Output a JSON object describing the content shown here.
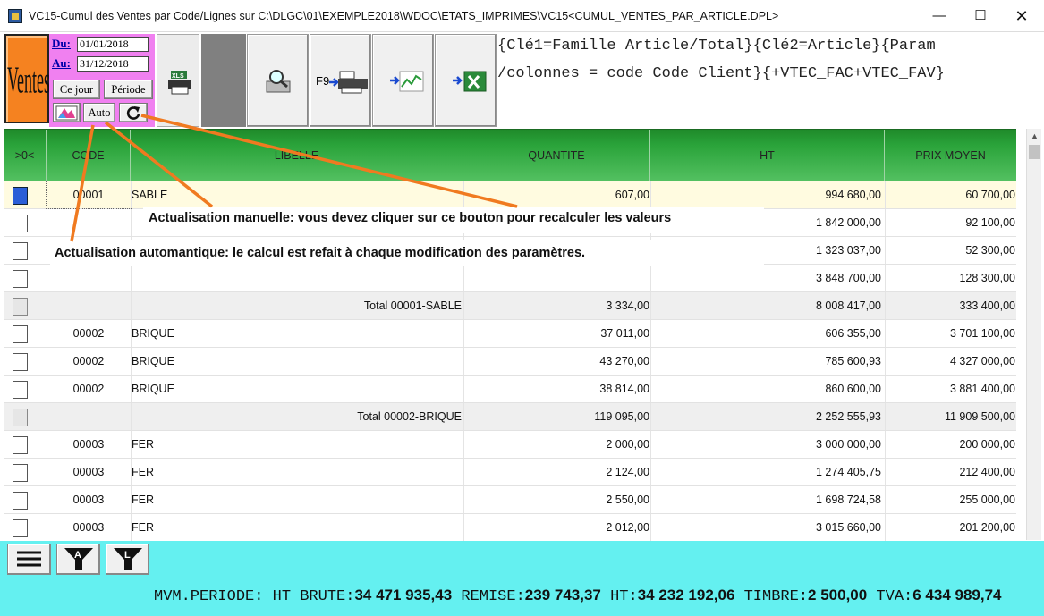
{
  "window": {
    "title": "VC15-Cumul des Ventes par Code/Lignes sur C:\\DLGC\\01\\EXEMPLE2018\\WDOC\\ETATS_IMPRIMES\\VC15<CUMUL_VENTES_PAR_ARTICLE.DPL>",
    "minimize": "—",
    "maximize": "☐",
    "close": "✕"
  },
  "toolbar": {
    "ventes_label": "Ventes",
    "du_label": "Du:",
    "du_value": "01/01/2018",
    "au_label": "Au:",
    "au_value": "31/12/2018",
    "ce_jour": "Ce jour",
    "periode": "Période",
    "auto": "Auto",
    "xls_label": "XLS",
    "f9_label": "F9"
  },
  "params": {
    "line1": "{Clé1=Famille Article/Total}{Clé2=Article}{Param",
    "line2": "/colonnes = code Code Client}{+VTEC_FAC+VTEC_FAV}"
  },
  "grid": {
    "headers": [
      ">0<",
      "CODE",
      "LIBELLE",
      "QUANTITE",
      "HT",
      "PRIX MOYEN"
    ],
    "rows": [
      {
        "type": "sel",
        "code": "00001",
        "lib": "SABLE",
        "q": "607,00",
        "ht": "994 680,00",
        "pm": "60 700,00"
      },
      {
        "type": "data",
        "code": "",
        "lib": "",
        "q": "",
        "ht": "1 842 000,00",
        "pm": "92 100,00"
      },
      {
        "type": "data",
        "code": "",
        "lib": "",
        "q": "",
        "ht": "1 323 037,00",
        "pm": "52 300,00"
      },
      {
        "type": "data",
        "code": "",
        "lib": "",
        "q": "",
        "ht": "3 848 700,00",
        "pm": "128 300,00"
      },
      {
        "type": "tot",
        "label": "Total 00001-SABLE",
        "q": "3 334,00",
        "ht": "8 008 417,00",
        "pm": "333 400,00"
      },
      {
        "type": "data",
        "code": "00002",
        "lib": "BRIQUE",
        "q": "37 011,00",
        "ht": "606 355,00",
        "pm": "3 701 100,00"
      },
      {
        "type": "data",
        "code": "00002",
        "lib": "BRIQUE",
        "q": "43 270,00",
        "ht": "785 600,93",
        "pm": "4 327 000,00"
      },
      {
        "type": "data",
        "code": "00002",
        "lib": "BRIQUE",
        "q": "38 814,00",
        "ht": "860 600,00",
        "pm": "3 881 400,00"
      },
      {
        "type": "tot",
        "label": "Total 00002-BRIQUE",
        "q": "119 095,00",
        "ht": "2 252 555,93",
        "pm": "11 909 500,00"
      },
      {
        "type": "data",
        "code": "00003",
        "lib": "FER",
        "q": "2 000,00",
        "ht": "3 000 000,00",
        "pm": "200 000,00"
      },
      {
        "type": "data",
        "code": "00003",
        "lib": "FER",
        "q": "2 124,00",
        "ht": "1 274 405,75",
        "pm": "212 400,00"
      },
      {
        "type": "data",
        "code": "00003",
        "lib": "FER",
        "q": "2 550,00",
        "ht": "1 698 724,58",
        "pm": "255 000,00"
      },
      {
        "type": "data",
        "code": "00003",
        "lib": "FER",
        "q": "2 012,00",
        "ht": "3 015 660,00",
        "pm": "201 200,00"
      }
    ]
  },
  "annotations": {
    "manual": "Actualisation manuelle: vous devez cliquer sur ce bouton pour recalculer les valeurs",
    "auto": "Actualisation automantique: le calcul est refait à chaque modification des paramètres."
  },
  "status": {
    "prefix": "MVM.PERIODE: HT BRUTE:",
    "ht_brute": "34 471 935,43",
    "remise_label": " REMISE:",
    "remise": "239 743,37",
    "ht_label": " HT:",
    "ht": "34 232 192,06",
    "timbre_label": " TIMBRE:",
    "timbre": "2 500,00",
    "tva_label": " TVA:",
    "tva": "6 434 989,74"
  },
  "colors": {
    "ventes": "#f58220",
    "date_panel": "#f080f0",
    "grid_header": "#2aa33a",
    "bottom_bar": "#64f0f0",
    "annotation_arrow": "#f07a20"
  }
}
